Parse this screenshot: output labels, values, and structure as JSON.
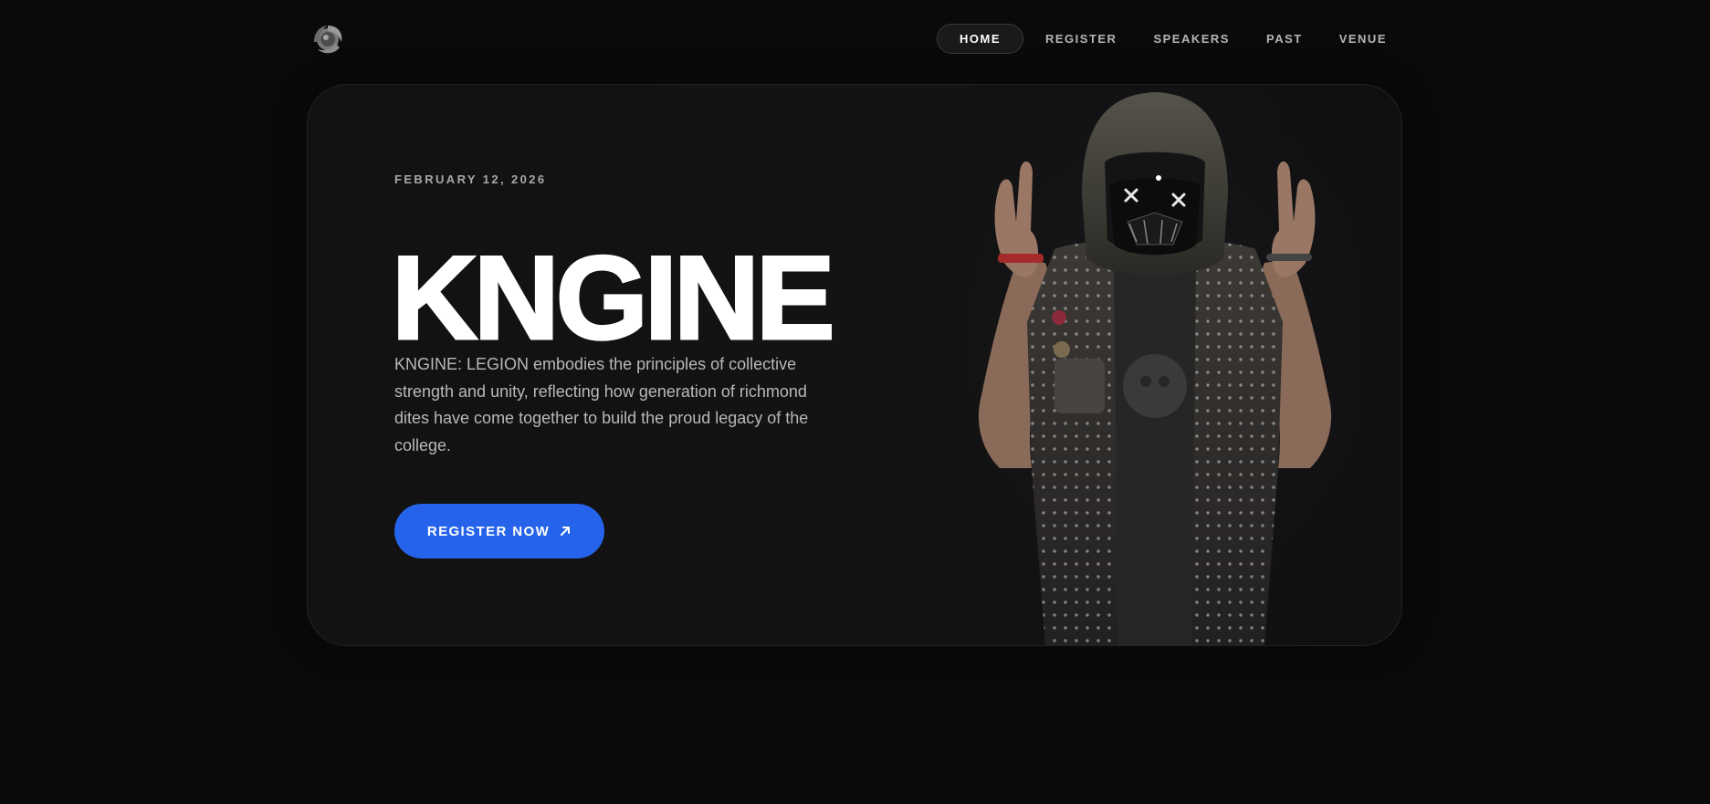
{
  "header": {
    "logo_icon": "spiral-globe-logo",
    "nav": [
      {
        "label": "HOME",
        "active": true
      },
      {
        "label": "REGISTER",
        "active": false
      },
      {
        "label": "SPEAKERS",
        "active": false
      },
      {
        "label": "PAST",
        "active": false
      },
      {
        "label": "VENUE",
        "active": false
      }
    ]
  },
  "hero": {
    "date": "FEBRUARY 12, 2026",
    "title": "KNGINE",
    "description": "KNGINE: LEGION embodies the principles of collective strength and unity, reflecting how generation of richmond dites have come together to build the proud legacy of the college.",
    "cta_label": "REGISTER NOW",
    "cta_icon": "arrow-up-right-icon",
    "image_subject": "hooded-masked-figure-in-studded-jacket"
  },
  "colors": {
    "background": "#0a0a0a",
    "card": "#121212",
    "accent": "#2563eb",
    "text_primary": "#ffffff",
    "text_muted": "#b8b8b8"
  }
}
